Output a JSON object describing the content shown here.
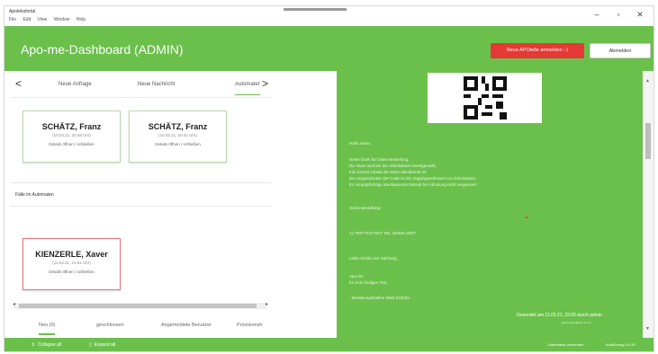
{
  "titlebar": {
    "app_title": "Apoteksfortal",
    "menu": [
      "File",
      "Edit",
      "View",
      "Window",
      "Help"
    ],
    "minimize": "–",
    "maximize": "▫",
    "close": "✕"
  },
  "header": {
    "title": "Apo-me-Dashboard (ADMIN)",
    "new_button": "Neue APOtelle anmelden :-)",
    "logout_button": "Abmelden"
  },
  "tabs": {
    "items": [
      "Neue Anfrage",
      "Neue Nachricht",
      "Automaten"
    ],
    "active_index": 2,
    "left_arrow": "<",
    "right_arrow": ">"
  },
  "cards": [
    {
      "name": "SCHÄTZ, Franz",
      "time": "(10.03.21, 20:48 Uhr)",
      "details": "Details öffnen / schließen"
    },
    {
      "name": "SCHÄTZ, Franz",
      "time": "(10.03.21, 20:42 Uhr)",
      "details": "Details öffnen / schließen"
    }
  ],
  "section_title": "Fälle im Automaten",
  "automat_card": {
    "name": "KIENZERLE, Xaver",
    "time": "(11.03.21, 21:51 Uhr)",
    "details": "Details öffnen / schließen"
  },
  "scrollbar": {
    "left": "◂",
    "right": "▸",
    "up": "▲",
    "down": "▼"
  },
  "bottom_tabs": {
    "items": [
      "Neu (0)",
      "geschlossen",
      "Angemeldete Benutzer",
      "Provisionsh"
    ],
    "active_index": 0
  },
  "message": {
    "greeting": "Hallo Xaver,",
    "lines": [
      "vielen Dank für Deine Bestellung.",
      "Die Ware wird bei der Abholstation bereitgestellt,",
      "Info kommt sobald die Ware abholbereit ist.",
      "Der mitgeschickte QR-Code ist der Zugangsschlüssel zur Abholstation,",
      "für rezeptpflichtige Medikamente Rezept bei Abholung nicht vergessen!"
    ],
    "order_label": "Deine Bestellung:",
    "order_item": "1x TRITTICO RET TBL 150MG 60ST",
    "regards": "Liebe Grüße aus Salzburg,",
    "signature1": "Apo-me",
    "signature2": "für Zum heiligen Test.",
    "hotline": "- Bestellungshotline 0662 022022 -",
    "sent": "Gesendet am 11.03.21, 22:00 durch admin",
    "sent_sub": "jakob.bauer@apo-me.at"
  },
  "footer": {
    "collapse": "Collapse all",
    "expand": "Expand all",
    "status": "Datenbank verbunden",
    "version": "Ausführung 0.9.19"
  },
  "colors": {
    "accent": "#6bc04b",
    "danger": "#e53935"
  }
}
